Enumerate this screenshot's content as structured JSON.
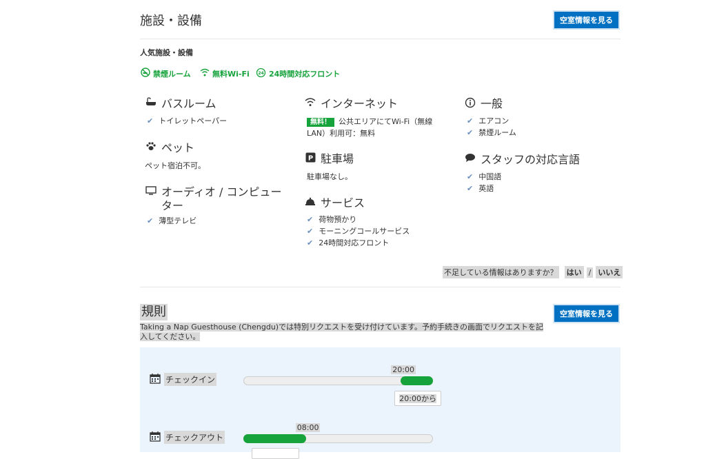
{
  "header": {
    "title": "施設・設備",
    "availability_button": "空室情報を見る"
  },
  "popular": {
    "heading": "人気施設・設備",
    "items": [
      {
        "icon": "no-smoking-icon",
        "label": "禁煙ルーム"
      },
      {
        "icon": "wifi-icon",
        "label": "無料Wi-Fi"
      },
      {
        "icon": "24h-icon",
        "label": "24時間対応フロント"
      }
    ]
  },
  "bathroom": {
    "icon": "bath-icon",
    "title": "バスルーム",
    "items": [
      "トイレットペーパー"
    ]
  },
  "pets": {
    "icon": "paw-icon",
    "title": "ペット",
    "text": "ペット宿泊不可。"
  },
  "av": {
    "icon": "monitor-icon",
    "title_line1": "オーディオ / コンピュー",
    "title_line2": "ター",
    "items": [
      "薄型テレビ"
    ]
  },
  "internet": {
    "icon": "wifi-icon",
    "title": "インターネット",
    "badge": "無料！",
    "text_line1": "公共エリアにてWi-Fi（無線",
    "text_line2": "LAN）利用可：無料"
  },
  "parking": {
    "icon": "parking-icon",
    "title": "駐車場",
    "text": "駐車場なし。"
  },
  "services": {
    "icon": "bell-icon",
    "title": "サービス",
    "items": [
      "荷物預かり",
      "モーニングコールサービス",
      "24時間対応フロント"
    ]
  },
  "general": {
    "icon": "info-icon",
    "title": "一般",
    "items": [
      "エアコン",
      "禁煙ルーム"
    ]
  },
  "languages": {
    "icon": "speech-bubble-icon",
    "title": "スタッフの対応言語",
    "items": [
      "中国語",
      "英語"
    ]
  },
  "feedback": {
    "question": "不足している情報はありますか？",
    "yes": "はい",
    "sep": "/",
    "no": "いいえ"
  },
  "rules": {
    "title": "規則",
    "availability_button": "空室情報を見る",
    "desc_line1": "Taking a Nap Guesthouse (Chengdu)では特別リクエストを受け付けています。予約手続きの画面でリクエストを記",
    "desc_line2": "入してください。",
    "checkin": {
      "label": "チェックイン",
      "time": "20:00",
      "tooltip": "20:00から",
      "start_fraction": 0.83,
      "end_fraction": 1.0
    },
    "checkout": {
      "label": "チェックアウト",
      "time": "08:00",
      "start_fraction": 0.0,
      "end_fraction": 0.33
    }
  },
  "colors": {
    "accent": "#0071c2",
    "green": "#17a33c",
    "panel": "#ebf3fc"
  }
}
